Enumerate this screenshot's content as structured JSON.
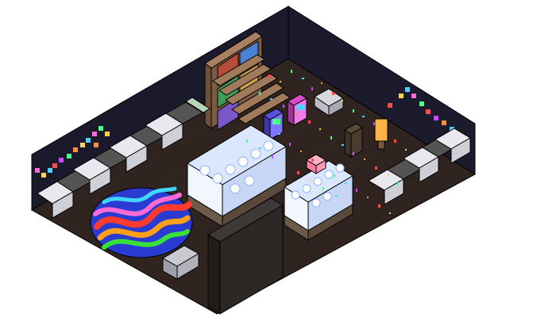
{
  "room": {
    "view": "isometric",
    "theme": "neon arcade cafe",
    "colors": {
      "background": "#ffffff",
      "wall_left": "#1b1a2c",
      "wall_back": "#1c1b2e",
      "floor": "#2f241f",
      "floor_line": "#3a2d26",
      "outline": "#000000",
      "sofa_green": "#b9d4b8",
      "sofa_white": "#e8e8ee",
      "table_top": "#545454",
      "bookcase_wood": "#8b6a4c",
      "rug_base": "#2a3bd1",
      "rug_stripe_1": "#ff3b30",
      "rug_stripe_2": "#ff9f1a",
      "rug_stripe_3": "#38e038",
      "rug_stripe_4": "#ff6ad5",
      "rug_stripe_5": "#3fd6ff",
      "counter_glass": "#dbe7ff",
      "counter_base": "#6e5a48",
      "partition": "#2b2826",
      "confetti": [
        "#ff4d4d",
        "#ffd34d",
        "#4dff88",
        "#4dd2ff",
        "#c94dff",
        "#ff8f3a"
      ]
    }
  },
  "objects": [
    {
      "name": "left-booth-row",
      "icon": "sofa-icon",
      "count": 5,
      "color": "sofa_green"
    },
    {
      "name": "right-booth-row",
      "icon": "sofa-icon",
      "count": 3,
      "color": "sofa_green"
    },
    {
      "name": "round-neon-rug",
      "icon": "rug-icon"
    },
    {
      "name": "bookcase-staircase",
      "icon": "bookshelf-icon"
    },
    {
      "name": "glass-display-counter",
      "icon": "display-case-icon",
      "count": 2
    },
    {
      "name": "arcade-cabinet",
      "icon": "arcade-icon",
      "count": 2
    },
    {
      "name": "floor-lamp",
      "icon": "lamp-icon"
    },
    {
      "name": "wall-pixel-blocks",
      "icon": "tetris-block-icon"
    },
    {
      "name": "confetti-floor",
      "icon": "confetti-icon"
    },
    {
      "name": "front-partition-wall",
      "icon": "wall-icon"
    },
    {
      "name": "small-gift-box",
      "icon": "gift-icon"
    }
  ]
}
